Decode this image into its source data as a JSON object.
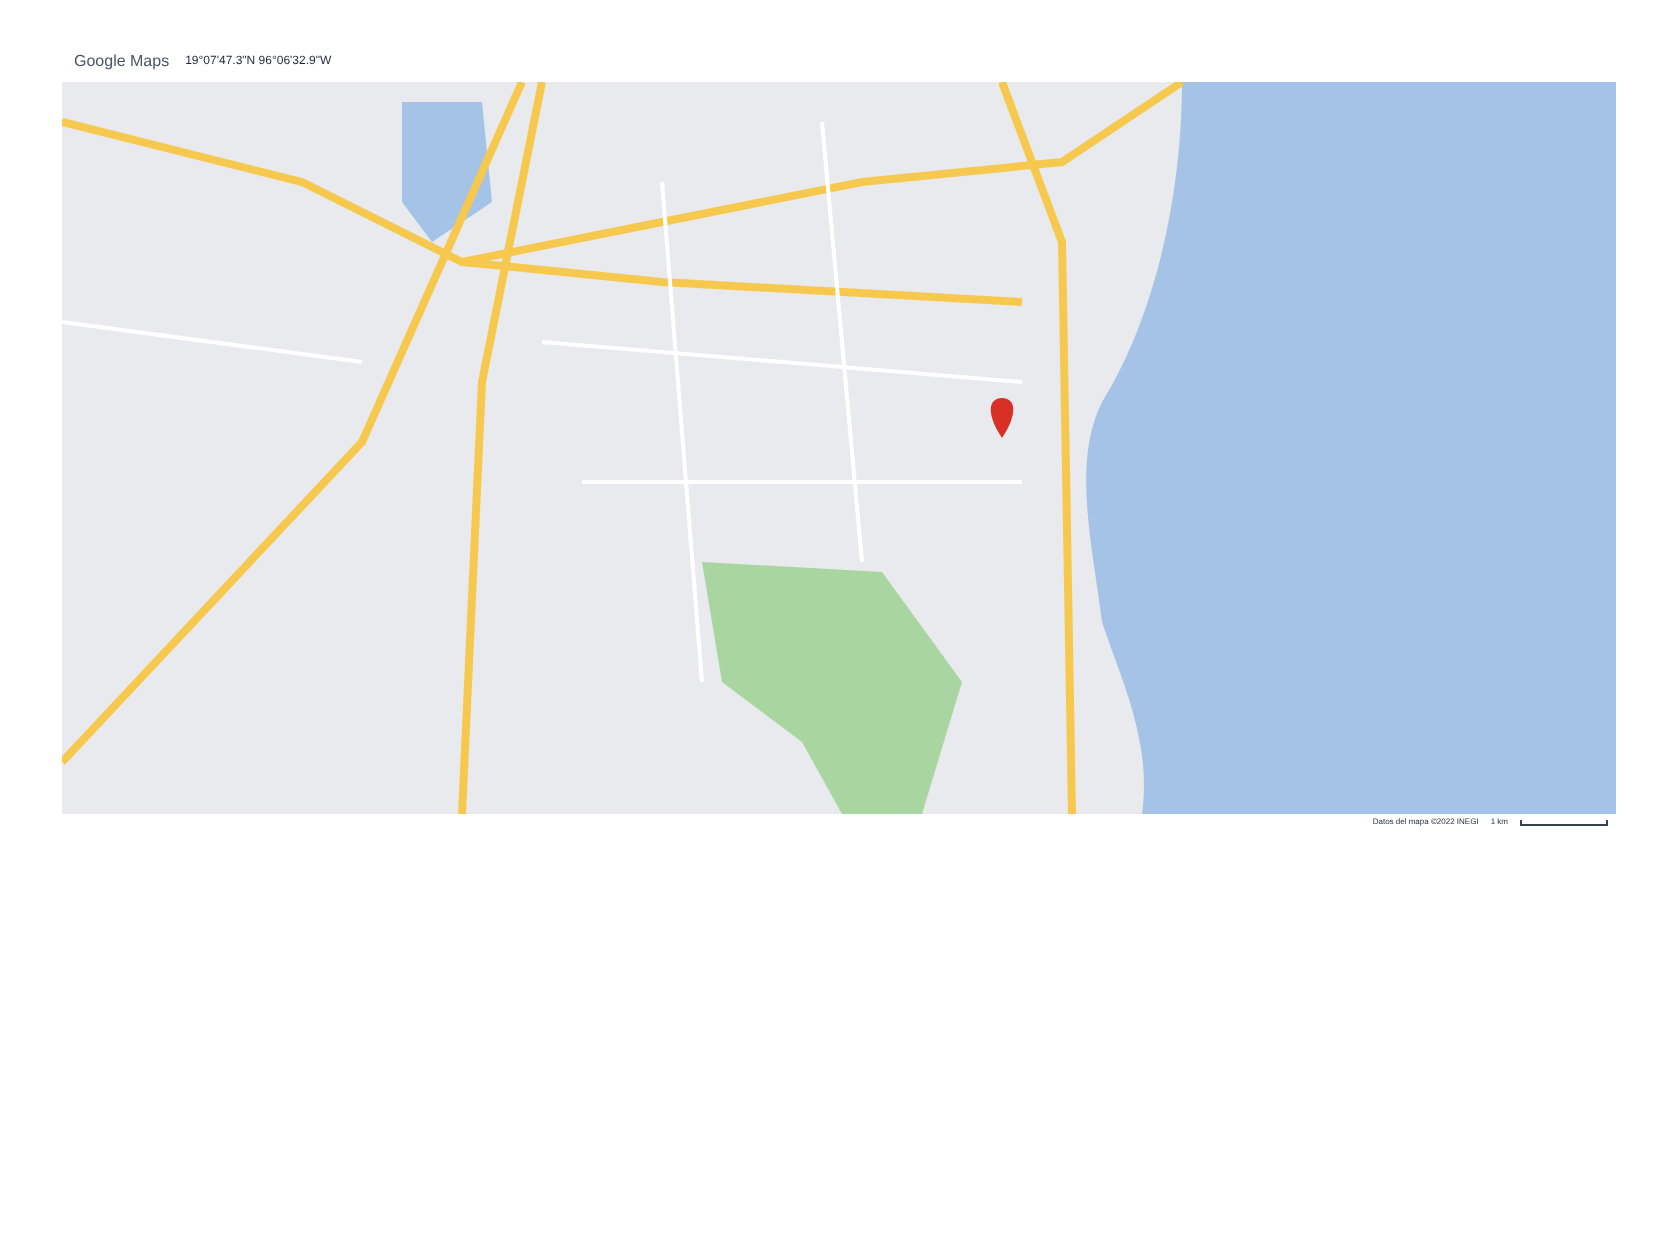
{
  "header": {
    "logo": "Google Maps",
    "coordinates": "19°07'47.3\"N 96°06'32.9\"W"
  },
  "footer": {
    "attribution": "Datos del mapa ©2022 INEGI",
    "scale": "1 km"
  }
}
